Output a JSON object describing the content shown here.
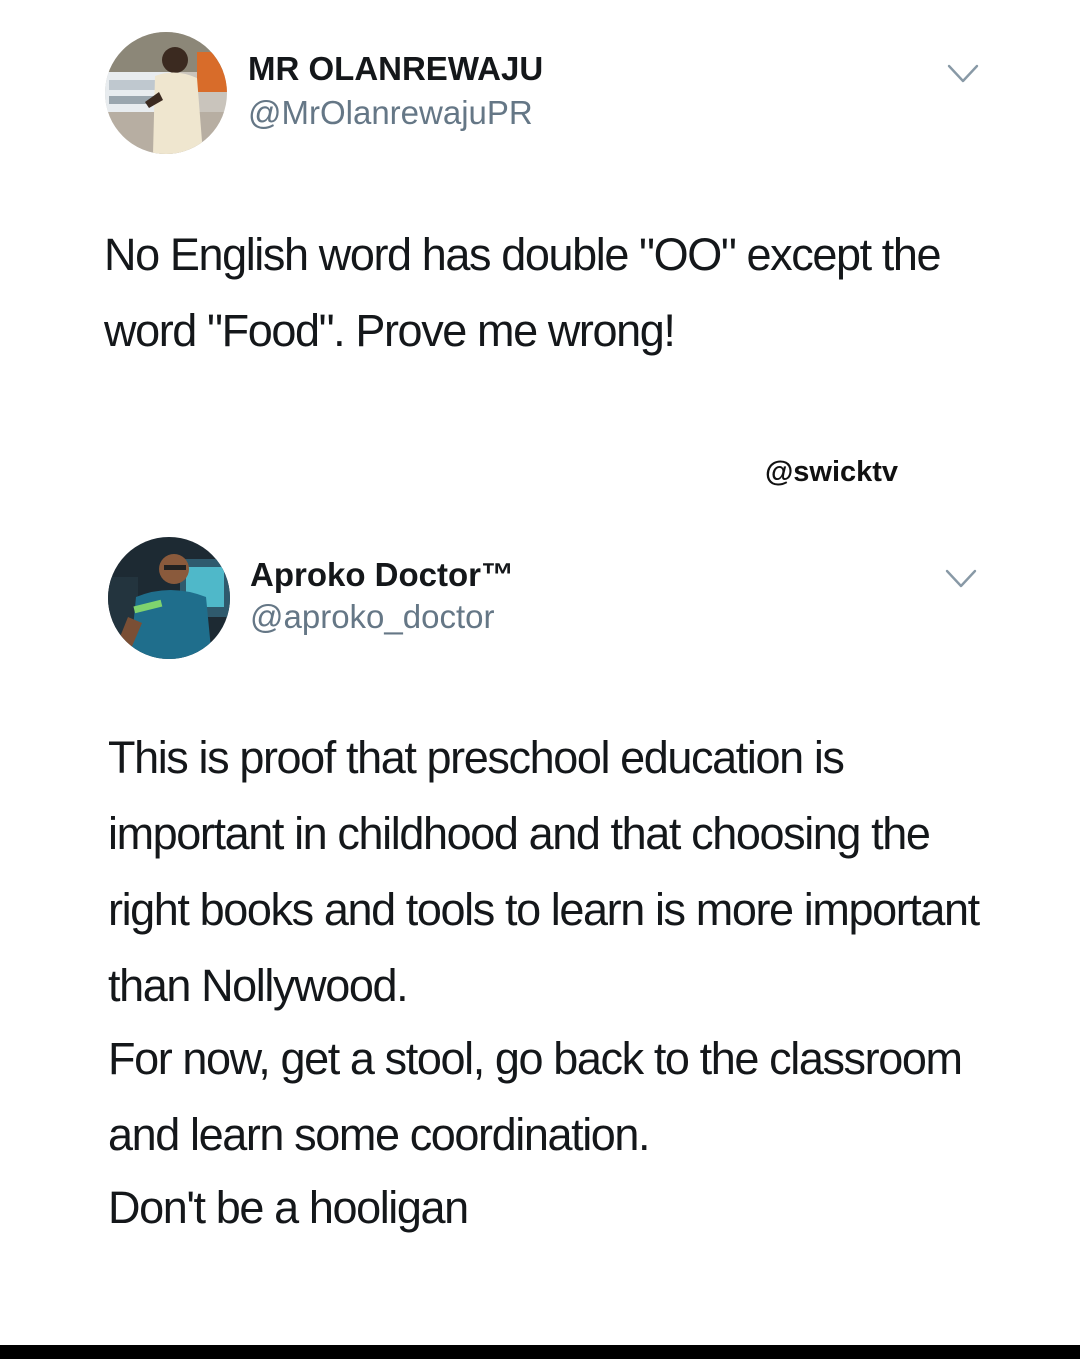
{
  "tweets": [
    {
      "display_name": "MR OLANREWAJU",
      "handle": "@MrOlanrewajuPR",
      "text": "No English word has double \"OO\" except the word \"Food\".  Prove me wrong!",
      "avatar_icon": "user-photo-avatar",
      "menu_icon": "chevron-down-icon"
    },
    {
      "display_name": "Aproko Doctor™",
      "handle": "@aproko_doctor",
      "paragraphs": [
        "This is proof that preschool education is important in childhood and that choosing the right books and tools to learn is more important than Nollywood.",
        "For now, get a stool, go back to the classroom and learn some coordination.",
        "Don't be a hooligan"
      ],
      "avatar_icon": "user-photo-avatar",
      "menu_icon": "chevron-down-icon"
    }
  ],
  "watermark": "@swicktv",
  "colors": {
    "background": "#ffffff",
    "text": "#14171a",
    "secondary_text": "#657786",
    "chevron": "#8899a6"
  }
}
